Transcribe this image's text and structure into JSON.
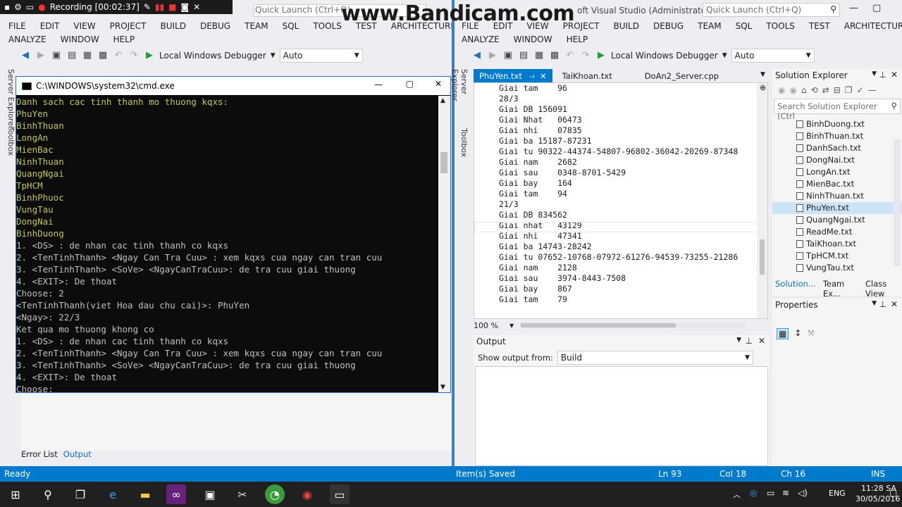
{
  "recording": {
    "label": "Recording [00:02:37]"
  },
  "watermark": "www.Bandicam.com",
  "left_vs": {
    "quick_launch": "Quick Launch (Ctrl+Q)",
    "menu": [
      "FILE",
      "EDIT",
      "VIEW",
      "PROJECT",
      "BUILD",
      "DEBUG",
      "TEAM",
      "SQL",
      "TOOLS",
      "TEST",
      "ARCHITECTURE"
    ],
    "menu2": [
      "ANALYZE",
      "WINDOW",
      "HELP"
    ],
    "debugger": "Local Windows Debugger",
    "config": "Auto",
    "side_tabs": [
      "Server Explorer",
      "Toolbox"
    ],
    "bottom_tabs": [
      "Error List",
      "Output"
    ]
  },
  "right_vs": {
    "title": "oft Visual Studio (Administrator)",
    "quick_launch": "Quick Launch (Ctrl+Q)",
    "menu": [
      "FILE",
      "EDIT",
      "VIEW",
      "PROJECT",
      "BUILD",
      "DEBUG",
      "TEAM",
      "SQL",
      "TOOLS",
      "TEST",
      "ARCHITECTURE"
    ],
    "menu2": [
      "ANALYZE",
      "WINDOW",
      "HELP"
    ],
    "debugger": "Local Windows Debugger",
    "config": "Auto",
    "tabs": [
      "PhuYen.txt",
      "TaiKhoan.txt",
      "DoAn2_Server.cpp"
    ],
    "side_tabs": [
      "Server Explorer",
      "Toolbox"
    ],
    "editor_lines": [
      "Giai tam    96",
      "28/3",
      "Giai DB 156091",
      "Giai Nhat   06473",
      "Giai nhi    07835",
      "Giai ba 15187-87231",
      "Giai tu 90322-44374-54807-96802-36042-20269-87348",
      "Giai nam    2682",
      "Giai sau    0348-8701-5429",
      "Giai bay    164",
      "Giai tam    94",
      "21/3",
      "Giai DB 834562",
      "Giai nhat   43129",
      "Giai nhi    47341",
      "Giai ba 14743-28242",
      "Giai tu 07652-10768-07972-61276-94539-73255-21286",
      "Giai nam    2128",
      "Giai sau    3974-8443-7508",
      "Giai bay    867",
      "Giai tam    79"
    ],
    "zoom": "100 %",
    "solution_explorer": {
      "title": "Solution Explorer",
      "search": "Search Solution Explorer (Ctrl",
      "files": [
        "BinhDuong.txt",
        "BinhThuan.txt",
        "DanhSach.txt",
        "DongNai.txt",
        "LongAn.txt",
        "MienBac.txt",
        "NinhThuan.txt",
        "PhuYen.txt",
        "QuangNgai.txt",
        "ReadMe.txt",
        "TaiKhoan.txt",
        "TpHCM.txt",
        "VungTau.txt"
      ],
      "bottom_tabs": [
        "Solution...",
        "Team Ex...",
        "Class View"
      ]
    },
    "properties": {
      "title": "Properties"
    },
    "output": {
      "title": "Output",
      "show_label": "Show output from:",
      "source": "Build"
    }
  },
  "cmd": {
    "title": "C:\\WINDOWS\\system32\\cmd.exe",
    "lines": [
      {
        "t": "Danh sach cac tinh thanh mo thuong kqxs:",
        "c": "y"
      },
      {
        "t": "PhuYen",
        "c": "y"
      },
      {
        "t": "BinhThuan",
        "c": "y"
      },
      {
        "t": "LongAn",
        "c": "y"
      },
      {
        "t": "MienBac",
        "c": "y"
      },
      {
        "t": "NinhThuan",
        "c": "y"
      },
      {
        "t": "QuangNgai",
        "c": "y"
      },
      {
        "t": "TpHCM",
        "c": "y"
      },
      {
        "t": "BinhPhuoc",
        "c": "y"
      },
      {
        "t": "VungTau",
        "c": "y"
      },
      {
        "t": "DongNai",
        "c": "y"
      },
      {
        "t": "BinhDuong",
        "c": "y"
      },
      {
        "t": "1. <DS> : de nhan cac tinh thanh co kqxs",
        "c": "w"
      },
      {
        "t": "2. <TenTinhThanh> <Ngay Can Tra Cuu> : xem kqxs cua ngay can tran cuu",
        "c": "w"
      },
      {
        "t": "3. <TenTinhThanh> <SoVe> <NgayCanTraCuu>: de tra cuu giai thuong",
        "c": "w"
      },
      {
        "t": "4. <EXIT>: De thoat",
        "c": "w"
      },
      {
        "t": "Choose: 2",
        "c": "w"
      },
      {
        "t": "<TenTinhThanh(viet Hoa dau chu cai)>: PhuYen",
        "c": "w"
      },
      {
        "t": "<Ngay>: 22/3",
        "c": "w"
      },
      {
        "t": "Ket qua mo thuong khong co",
        "c": "w"
      },
      {
        "t": "1. <DS> : de nhan cac tinh thanh co kqxs",
        "c": "w"
      },
      {
        "t": "2. <TenTinhThanh> <Ngay Can Tra Cuu> : xem kqxs cua ngay can tran cuu",
        "c": "w"
      },
      {
        "t": "3. <TenTinhThanh> <SoVe> <NgayCanTraCuu>: de tra cuu giai thuong",
        "c": "w"
      },
      {
        "t": "4. <EXIT>: De thoat",
        "c": "w"
      },
      {
        "t": "Choose:",
        "c": "w"
      }
    ]
  },
  "status": {
    "left": "Ready",
    "saved": "Item(s) Saved",
    "ln": "Ln 93",
    "col": "Col 18",
    "ch": "Ch 16",
    "ins": "INS"
  },
  "taskbar": {
    "lang": "ENG",
    "time": "11:28 SA",
    "date": "30/05/2016"
  },
  "colors": {
    "accent": "#007acc",
    "cmd_bg": "#0c0c0c",
    "cmd_yellow": "#c5c55a"
  }
}
